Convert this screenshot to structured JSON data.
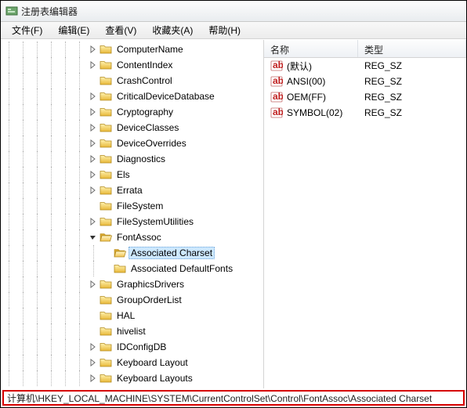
{
  "window": {
    "title": "注册表编辑器"
  },
  "menu": {
    "file": "文件(F)",
    "edit": "编辑(E)",
    "view": "查看(V)",
    "fav": "收藏夹(A)",
    "help": "帮助(H)"
  },
  "tree": {
    "items": [
      {
        "label": "ComputerName",
        "expander": "right"
      },
      {
        "label": "ContentIndex",
        "expander": "right"
      },
      {
        "label": "CrashControl",
        "expander": "none"
      },
      {
        "label": "CriticalDeviceDatabase",
        "expander": "right"
      },
      {
        "label": "Cryptography",
        "expander": "right"
      },
      {
        "label": "DeviceClasses",
        "expander": "right"
      },
      {
        "label": "DeviceOverrides",
        "expander": "right"
      },
      {
        "label": "Diagnostics",
        "expander": "right"
      },
      {
        "label": "Els",
        "expander": "right"
      },
      {
        "label": "Errata",
        "expander": "right"
      },
      {
        "label": "FileSystem",
        "expander": "none"
      },
      {
        "label": "FileSystemUtilities",
        "expander": "right"
      },
      {
        "label": "FontAssoc",
        "expander": "down",
        "open": true
      },
      {
        "label": "GraphicsDrivers",
        "expander": "right"
      },
      {
        "label": "GroupOrderList",
        "expander": "none"
      },
      {
        "label": "HAL",
        "expander": "none"
      },
      {
        "label": "hivelist",
        "expander": "none"
      },
      {
        "label": "IDConfigDB",
        "expander": "right"
      },
      {
        "label": "Keyboard Layout",
        "expander": "right"
      },
      {
        "label": "Keyboard Layouts",
        "expander": "right"
      }
    ],
    "fontassoc_children": [
      {
        "label": "Associated Charset",
        "selected": true
      },
      {
        "label": "Associated DefaultFonts",
        "selected": false
      }
    ]
  },
  "list": {
    "cols": {
      "name": "名称",
      "type": "类型"
    },
    "rows": [
      {
        "name": "(默认)",
        "type": "REG_SZ"
      },
      {
        "name": "ANSI(00)",
        "type": "REG_SZ"
      },
      {
        "name": "OEM(FF)",
        "type": "REG_SZ"
      },
      {
        "name": "SYMBOL(02)",
        "type": "REG_SZ"
      }
    ]
  },
  "status": {
    "path": "计算机\\HKEY_LOCAL_MACHINE\\SYSTEM\\CurrentControlSet\\Control\\FontAssoc\\Associated Charset"
  }
}
